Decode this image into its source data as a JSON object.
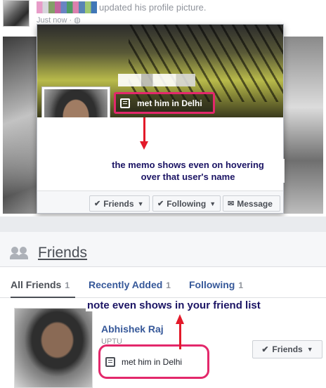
{
  "feed_post": {
    "action_text": "updated his profile picture.",
    "time_text": "Just now · ◍"
  },
  "hover_card": {
    "memo_text": "met him in Delhi",
    "buttons": {
      "friends": "Friends",
      "following": "Following",
      "message": "Message"
    }
  },
  "annotations": {
    "top_line1": "the memo shows even on hovering",
    "top_line2": "over that user's name",
    "bottom": "note even shows in your friend list"
  },
  "friends_section": {
    "title": "Friends",
    "tabs": [
      {
        "label": "All Friends",
        "count": "1"
      },
      {
        "label": "Recently Added",
        "count": "1"
      },
      {
        "label": "Following",
        "count": "1"
      }
    ],
    "friend": {
      "name": "Abhishek Raj",
      "subtitle": "UPTU",
      "memo_text": "met him in Delhi",
      "button_label": "Friends"
    }
  },
  "colors": {
    "highlight": "#e3286b",
    "arrow": "#e31a2a",
    "annotation_text": "#1b1464",
    "link": "#365899"
  }
}
